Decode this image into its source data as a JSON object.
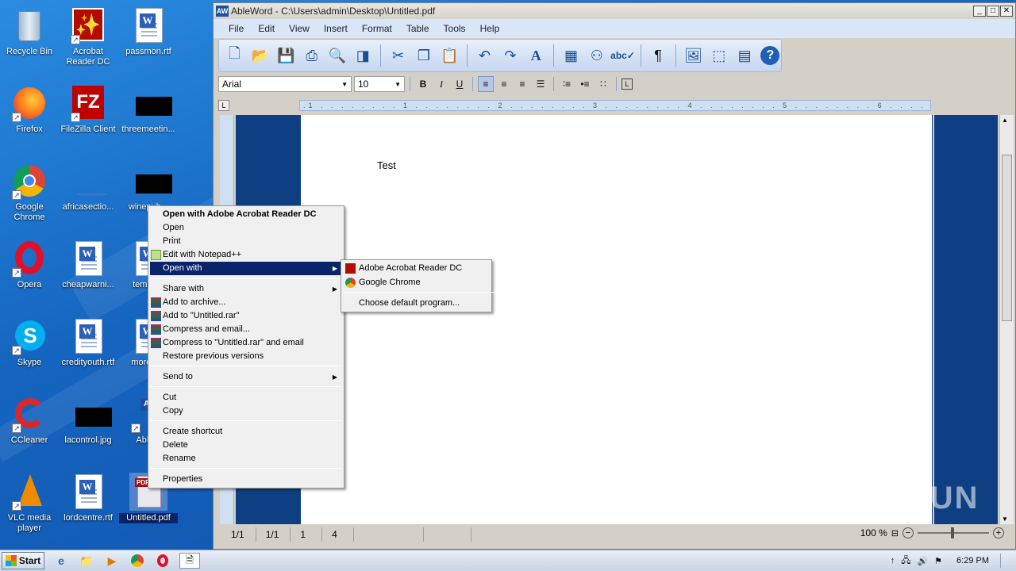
{
  "desktop": {
    "icons": [
      {
        "label": "Recycle Bin"
      },
      {
        "label": "Acrobat Reader DC"
      },
      {
        "label": "passmon.rtf"
      },
      {
        "label": "Firefox"
      },
      {
        "label": "FileZilla Client"
      },
      {
        "label": "threemeetin..."
      },
      {
        "label": "Google Chrome"
      },
      {
        "label": "africasectio..."
      },
      {
        "label": "winepub..."
      },
      {
        "label": "Opera"
      },
      {
        "label": "cheapwarni..."
      },
      {
        "label": "tempe..."
      },
      {
        "label": "Skype"
      },
      {
        "label": "credityouth.rtf"
      },
      {
        "label": "morem..."
      },
      {
        "label": "CCleaner"
      },
      {
        "label": "lacontrol.jpg"
      },
      {
        "label": "Able..."
      },
      {
        "label": "VLC media player"
      },
      {
        "label": "lordcentre.rtf"
      },
      {
        "label": "Untitled.pdf"
      }
    ]
  },
  "window": {
    "title": "AbleWord - C:\\Users\\admin\\Desktop\\Untitled.pdf",
    "menu": [
      "File",
      "Edit",
      "View",
      "Insert",
      "Format",
      "Table",
      "Tools",
      "Help"
    ],
    "font_name": "Arial",
    "font_size": "10",
    "document_text": "Test",
    "status": [
      "1/1",
      "1/1",
      "1",
      "4"
    ],
    "zoom": "100 %"
  },
  "context_menu": {
    "items": [
      {
        "label": "Open with Adobe Acrobat Reader DC"
      },
      {
        "label": "Open"
      },
      {
        "label": "Print"
      },
      {
        "label": "Edit with Notepad++"
      },
      {
        "label": "Open with"
      },
      {
        "label": "Share with"
      },
      {
        "label": "Add to archive..."
      },
      {
        "label": "Add to \"Untitled.rar\""
      },
      {
        "label": "Compress and email..."
      },
      {
        "label": "Compress to \"Untitled.rar\" and email"
      },
      {
        "label": "Restore previous versions"
      },
      {
        "label": "Send to"
      },
      {
        "label": "Cut"
      },
      {
        "label": "Copy"
      },
      {
        "label": "Create shortcut"
      },
      {
        "label": "Delete"
      },
      {
        "label": "Rename"
      },
      {
        "label": "Properties"
      }
    ]
  },
  "submenu": {
    "items": [
      {
        "label": "Adobe Acrobat Reader DC"
      },
      {
        "label": "Google Chrome"
      },
      {
        "label": "Choose default program..."
      }
    ]
  },
  "watermark": "ANY RUN",
  "taskbar": {
    "start_label": "Start",
    "clock": "6:29 PM"
  },
  "colors": {
    "desktop_bg": "#1565c0",
    "menu_highlight": "#0a246a",
    "document_frame": "#0d3f82"
  }
}
